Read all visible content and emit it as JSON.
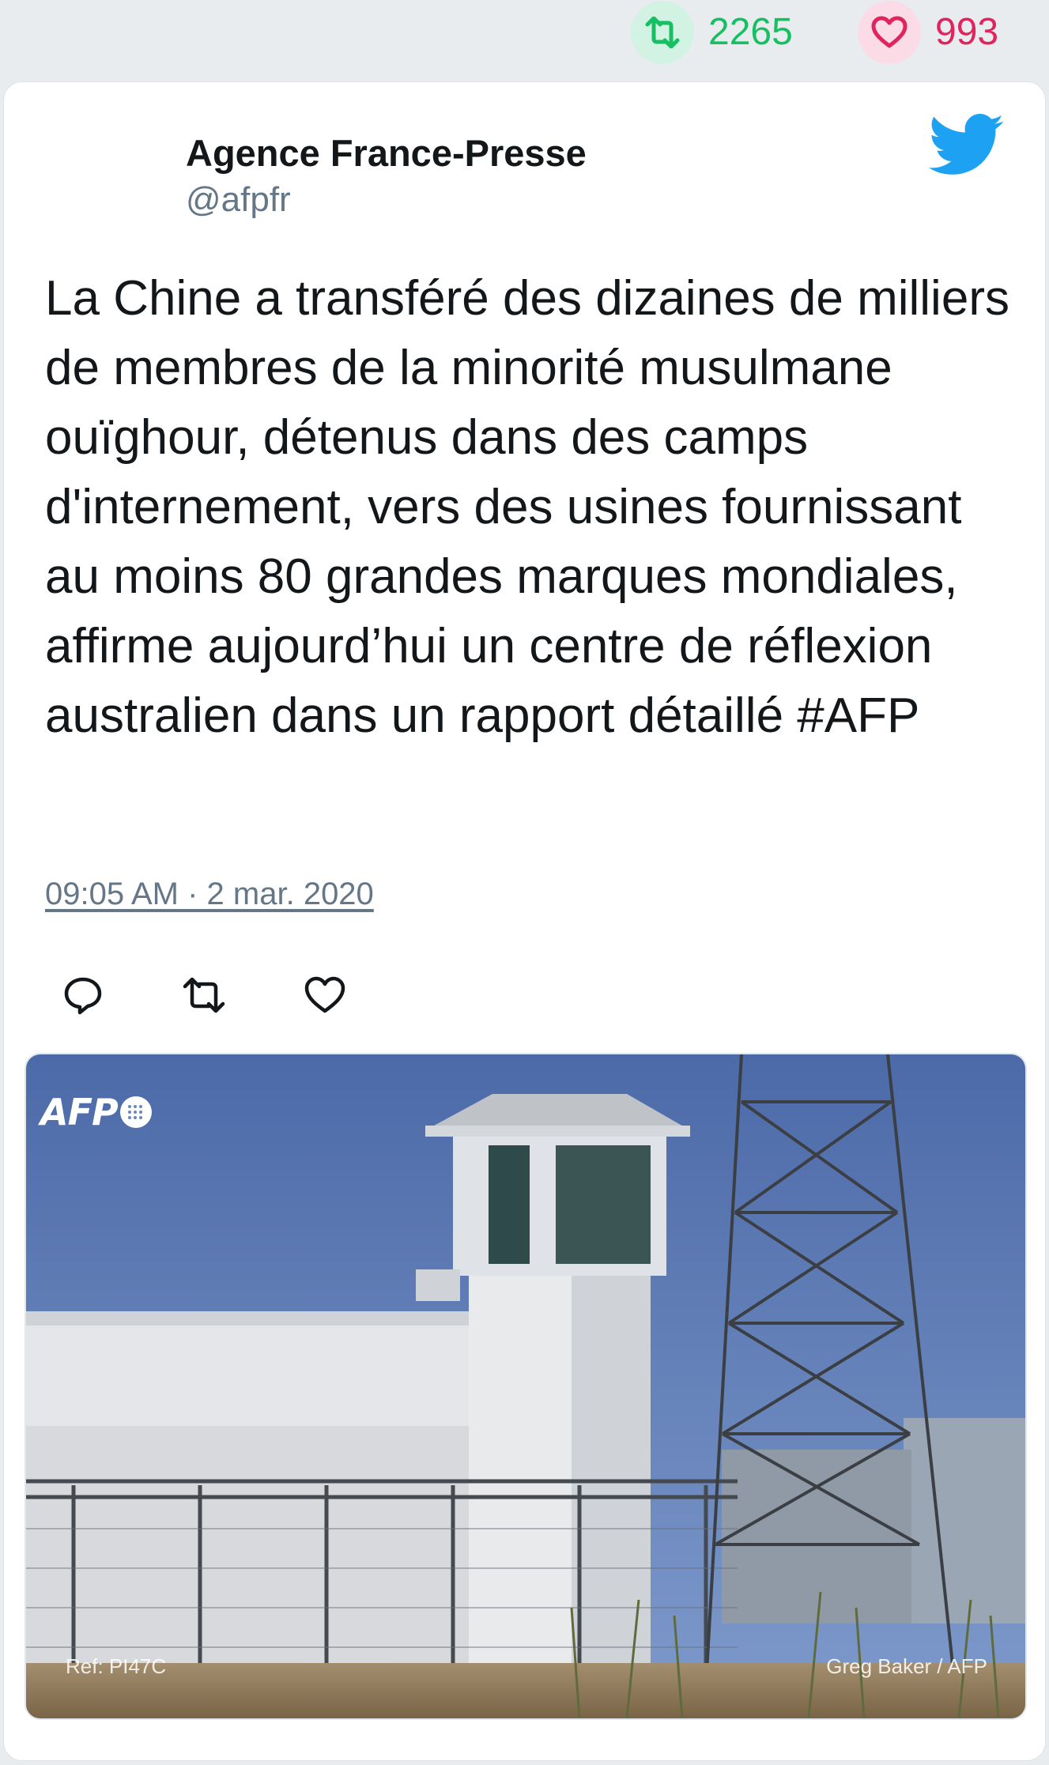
{
  "stats": {
    "retweets": "2265",
    "likes": "993",
    "retweet_color": "#17bf63",
    "like_color": "#e0245e"
  },
  "tweet": {
    "author_name": "Agence France-Presse",
    "author_handle": "@afpfr",
    "text": "La Chine a transféré des dizaines de milliers de membres de la minorité musulmane ouïghour, détenus dans des camps d'internement, vers des usines fournissant au moins 80 grandes marques mondiales, affirme aujourd’hui un centre de réflexion australien dans un rapport détaillé #AFP",
    "timestamp": "09:05 AM · 2 mar. 2020",
    "brand_icon": "twitter-bird-icon",
    "brand_color": "#1da1f2"
  },
  "actions": [
    "reply-icon",
    "retweet-icon",
    "like-icon"
  ],
  "photo": {
    "logo_text": "AFP",
    "ref": "Ref: PI47C",
    "credit": "Greg Baker / AFP"
  }
}
